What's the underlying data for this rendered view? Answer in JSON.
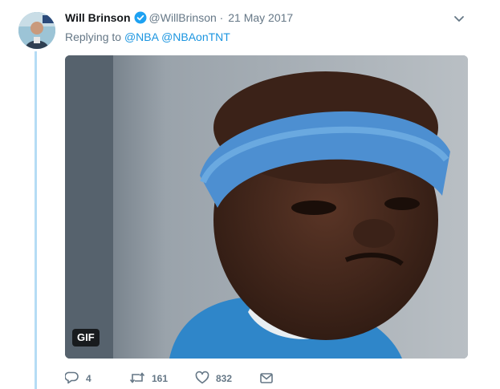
{
  "tweet": {
    "author_name": "Will Brinson",
    "handle": "@WillBrinson",
    "separator": "·",
    "date": "21 May 2017",
    "replying_to_label": "Replying to",
    "mentions": [
      "@NBA",
      "@NBAonTNT"
    ],
    "media_badge": "GIF",
    "verified_color": "#1da1f2",
    "accent_color": "#1b95e0"
  },
  "actions": {
    "reply_count": "4",
    "retweet_count": "161",
    "like_count": "832"
  },
  "icons": [
    "avatar",
    "verified-icon",
    "chevron-down-icon",
    "reply-icon",
    "retweet-icon",
    "like-icon",
    "message-icon"
  ]
}
